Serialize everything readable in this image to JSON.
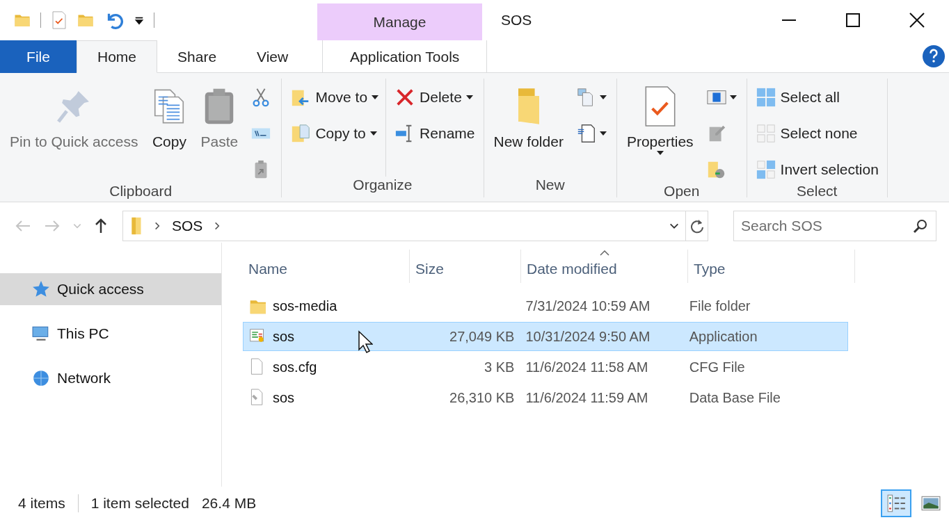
{
  "window": {
    "title": "SOS",
    "context_header": "Manage"
  },
  "tabs": [
    {
      "label": "File",
      "kind": "file",
      "selected": false
    },
    {
      "label": "Home",
      "kind": "normal",
      "selected": true
    },
    {
      "label": "Share",
      "kind": "normal",
      "selected": false
    },
    {
      "label": "View",
      "kind": "normal",
      "selected": false
    },
    {
      "label": "Application Tools",
      "kind": "contextual",
      "selected": false
    }
  ],
  "ribbon": [
    {
      "label": "Clipboard",
      "columns": [
        [
          {
            "kind": "large",
            "label": "Pin to Quick access",
            "disabled": true,
            "dropdown": false
          }
        ],
        [
          {
            "kind": "large",
            "label": "Copy",
            "disabled": false,
            "dropdown": false
          }
        ],
        [
          {
            "kind": "large",
            "label": "Paste",
            "disabled": true,
            "dropdown": false
          }
        ],
        [
          {
            "kind": "icon",
            "disabled": false,
            "dropdown": false
          },
          {
            "kind": "icon",
            "disabled": false,
            "dropdown": false
          },
          {
            "kind": "icon",
            "disabled": true,
            "dropdown": false
          }
        ]
      ]
    },
    {
      "label": "Organize",
      "columns": [
        [
          {
            "kind": "small",
            "label": "Move to",
            "disabled": false,
            "dropdown": true
          },
          {
            "kind": "small",
            "label": "Copy to",
            "disabled": false,
            "dropdown": true
          }
        ],
        [
          {
            "kind": "small",
            "label": "Delete",
            "disabled": false,
            "dropdown": true
          },
          {
            "kind": "small",
            "label": "Rename",
            "disabled": false,
            "dropdown": false
          }
        ]
      ]
    },
    {
      "label": "New",
      "columns": [
        [
          {
            "kind": "large",
            "label": "New folder",
            "disabled": false,
            "dropdown": false
          }
        ],
        [
          {
            "kind": "icon",
            "disabled": false,
            "dropdown": true
          },
          {
            "kind": "icon",
            "disabled": false,
            "dropdown": true
          }
        ]
      ]
    },
    {
      "label": "Open",
      "columns": [
        [
          {
            "kind": "large",
            "label": "Properties",
            "disabled": false,
            "dropdown": true
          }
        ],
        [
          {
            "kind": "icon",
            "disabled": false,
            "dropdown": true
          },
          {
            "kind": "icon",
            "disabled": true,
            "dropdown": false
          },
          {
            "kind": "icon",
            "disabled": false,
            "dropdown": false
          }
        ]
      ]
    },
    {
      "label": "Select",
      "columns": [
        [
          {
            "kind": "small",
            "label": "Select all",
            "disabled": false,
            "dropdown": false
          },
          {
            "kind": "small",
            "label": "Select none",
            "disabled": false,
            "dropdown": false
          },
          {
            "kind": "small",
            "label": "Invert selection",
            "disabled": false,
            "dropdown": false
          }
        ]
      ]
    }
  ],
  "address": {
    "path": [
      "SOS"
    ]
  },
  "search": {
    "placeholder": "Search SOS"
  },
  "sidebar": {
    "items": [
      {
        "label": "Quick access",
        "kind": "star",
        "selected": true
      },
      {
        "label": "This PC",
        "kind": "pc",
        "selected": false
      },
      {
        "label": "Network",
        "kind": "network",
        "selected": false
      }
    ]
  },
  "table": {
    "columns": [
      {
        "label": "Name",
        "sorted": false
      },
      {
        "label": "Size",
        "sorted": false
      },
      {
        "label": "Date modified",
        "sorted": true
      },
      {
        "label": "Type",
        "sorted": false
      }
    ],
    "rows": [
      {
        "name": "sos-media",
        "size": "",
        "date": "7/31/2024 10:59 AM",
        "type": "File folder",
        "kind": "folder",
        "selected": false
      },
      {
        "name": "sos",
        "size": "27,049 KB",
        "date": "10/31/2024 9:50 AM",
        "type": "Application",
        "kind": "app",
        "selected": true
      },
      {
        "name": "sos.cfg",
        "size": "3 KB",
        "date": "11/6/2024 11:58 AM",
        "type": "CFG File",
        "kind": "file",
        "selected": false
      },
      {
        "name": "sos",
        "size": "26,310 KB",
        "date": "11/6/2024 11:59 AM",
        "type": "Data Base File",
        "kind": "database",
        "selected": false
      }
    ]
  },
  "status_bar": {
    "count": "4 items",
    "selection": "1 item selected",
    "selection_size": "26.4 MB",
    "views": [
      {
        "kind": "details",
        "selected": true
      },
      {
        "kind": "large-icons",
        "selected": false
      }
    ]
  }
}
